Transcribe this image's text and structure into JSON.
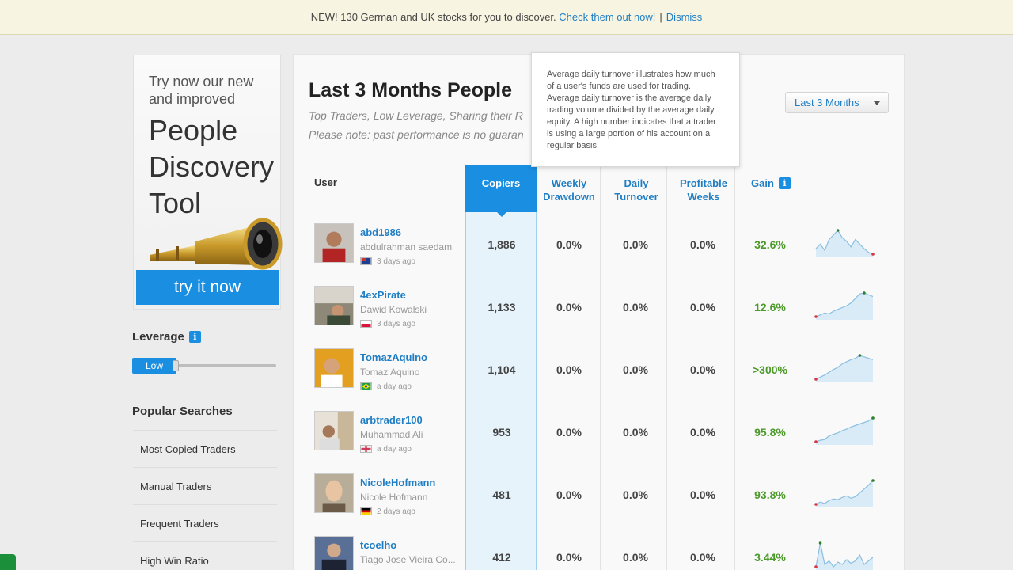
{
  "banner": {
    "text": "NEW! 130 German and UK stocks for you to discover.",
    "link": "Check them out now!",
    "separator": "|",
    "dismiss": "Dismiss"
  },
  "promo": {
    "small_text": "Try now our new and improved",
    "big_text": "People Discovery Tool",
    "button": "try it now",
    "image_icon": "telescope-icon"
  },
  "leverage": {
    "title": "Leverage",
    "info_icon": "i",
    "slider_label": "Low",
    "level": 0.25
  },
  "popular": {
    "title": "Popular Searches",
    "items": [
      "Most Copied Traders",
      "Manual Traders",
      "Frequent Traders",
      "High Win Ratio"
    ]
  },
  "main": {
    "title": "Last 3 Months People",
    "subtitle": "Top Traders, Low Leverage, Sharing their R",
    "note": "Please note: past performance is no guaran",
    "period": "Last 3 Months",
    "tooltip": "Average daily turnover illustrates how much of a user's funds are used for trading. Average daily turnover is the average daily trading volume divided by the average daily equity. A high number indicates that a trader is using a large portion of his account on a regular basis."
  },
  "columns": {
    "user": "User",
    "copiers": "Copiers",
    "weekly_drawdown": "Weekly Drawdown",
    "daily_turnover": "Daily Turnover",
    "profitable_weeks": "Profitable Weeks",
    "gain": "Gain",
    "gain_info": "i"
  },
  "rows": [
    {
      "username": "abd1986",
      "realname": "abdulrahman saedam",
      "ago": "3 days ago",
      "copiers": "1,886",
      "drawdown": "0.0%",
      "turnover": "0.0%",
      "profitable": "0.0%",
      "gain": "32.6%",
      "spark": [
        50,
        55,
        48,
        60,
        65,
        70,
        62,
        58,
        52,
        60,
        55,
        50,
        46,
        44
      ]
    },
    {
      "username": "4exPirate",
      "realname": "Dawid Kowalski",
      "ago": "3 days ago",
      "copiers": "1,133",
      "drawdown": "0.0%",
      "turnover": "0.0%",
      "profitable": "0.0%",
      "gain": "12.6%",
      "spark": [
        40,
        42,
        44,
        43,
        46,
        48,
        50,
        52,
        55,
        60,
        65,
        66,
        64,
        62
      ]
    },
    {
      "username": "TomazAquino",
      "realname": "Tomaz Aquino",
      "ago": "a day ago",
      "copiers": "1,104",
      "drawdown": "0.0%",
      "turnover": "0.0%",
      "profitable": "0.0%",
      "gain": ">300%",
      "spark": [
        30,
        33,
        36,
        40,
        44,
        47,
        52,
        55,
        58,
        60,
        64,
        62,
        60,
        58
      ]
    },
    {
      "username": "arbtrader100",
      "realname": "Muhammad Ali",
      "ago": "a day ago",
      "copiers": "953",
      "drawdown": "0.0%",
      "turnover": "0.0%",
      "profitable": "0.0%",
      "gain": "95.8%",
      "spark": [
        30,
        32,
        33,
        38,
        40,
        42,
        45,
        47,
        50,
        52,
        54,
        56,
        58,
        62
      ]
    },
    {
      "username": "NicoleHofmann",
      "realname": "Nicole Hofmann",
      "ago": "2 days ago",
      "copiers": "481",
      "drawdown": "0.0%",
      "turnover": "0.0%",
      "profitable": "0.0%",
      "gain": "93.8%",
      "spark": [
        35,
        38,
        36,
        40,
        42,
        41,
        44,
        46,
        43,
        45,
        50,
        55,
        60,
        66
      ]
    },
    {
      "username": "tcoelho",
      "realname": "Tiago Jose Vieira Co...",
      "ago": "",
      "copiers": "412",
      "drawdown": "0.0%",
      "turnover": "0.0%",
      "profitable": "0.0%",
      "gain": "3.44%",
      "spark": [
        40,
        60,
        42,
        45,
        40,
        44,
        42,
        46,
        43,
        45,
        50,
        42,
        45,
        48
      ]
    }
  ],
  "colors": {
    "accent": "#1a8ee0",
    "link": "#1f7ec4",
    "gain": "#4c9a2a"
  }
}
